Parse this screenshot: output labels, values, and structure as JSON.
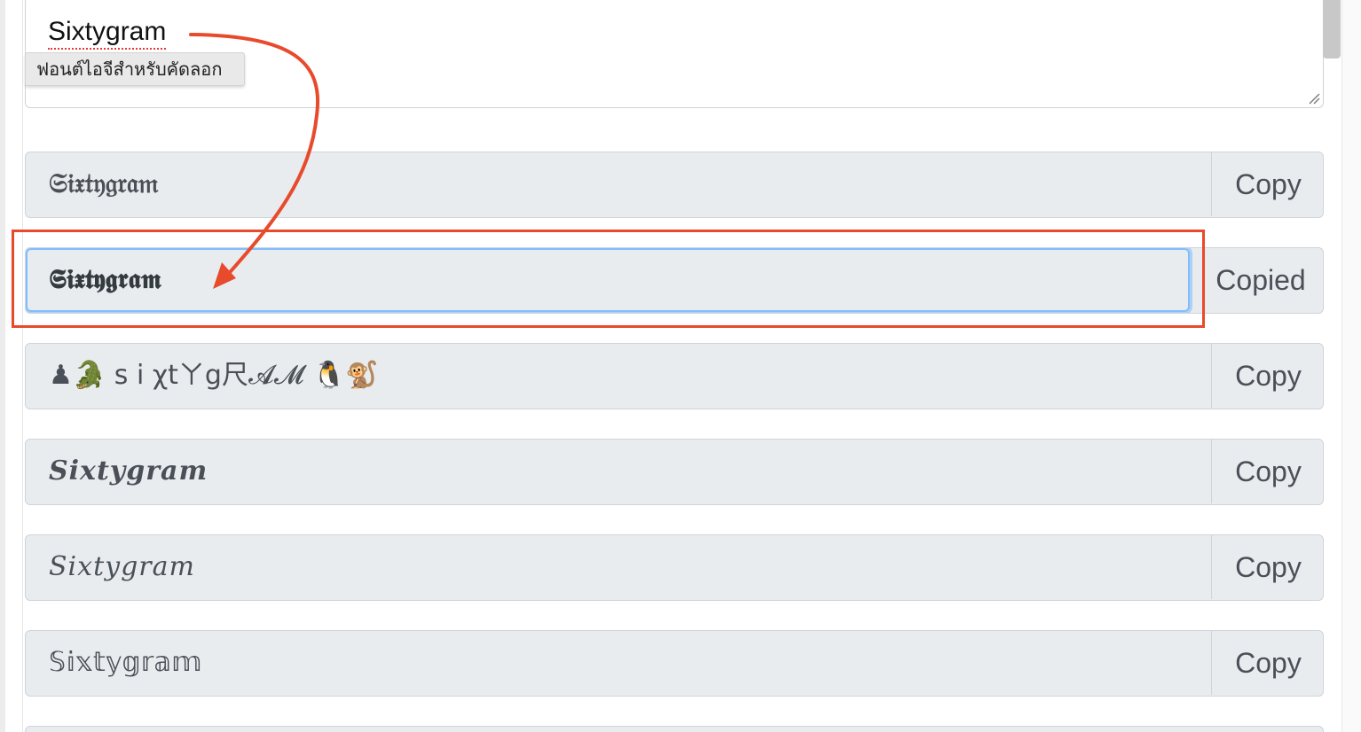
{
  "textarea": {
    "value": "Sixtygram"
  },
  "tooltip": {
    "text": "ฟอนต์ไอจีสำหรับคัดลอก"
  },
  "rows": [
    {
      "text": "𝔖𝔦𝔵𝔱𝔶𝔤𝔯𝔞𝔪",
      "button": "Copy"
    },
    {
      "text": "𝕾𝖎𝖝𝖙𝖞𝖌𝖗𝖆𝖒",
      "button": "Copied"
    },
    {
      "text": "♟🐊  s i χtㄚg尺𝓐𝓜  🐧🐒",
      "button": "Copy"
    },
    {
      "text": "𝑺𝒊𝒙𝒕𝒚𝒈𝒓𝒂𝒎",
      "button": "Copy"
    },
    {
      "text": "𝑆𝑖𝑥𝑡𝑦𝑔𝑟𝑎𝑚",
      "button": "Copy"
    },
    {
      "text": "𝕊𝕚𝕩𝕥𝕪𝕘𝕣𝕒𝕞",
      "button": "Copy"
    }
  ],
  "colors": {
    "highlight": "#e84a2c",
    "focus": "#80bdff",
    "field_bg": "#e9ecef"
  },
  "icons": {
    "resize": "resize-grip-icon",
    "annotation_arrow": "curved-arrow-icon"
  }
}
